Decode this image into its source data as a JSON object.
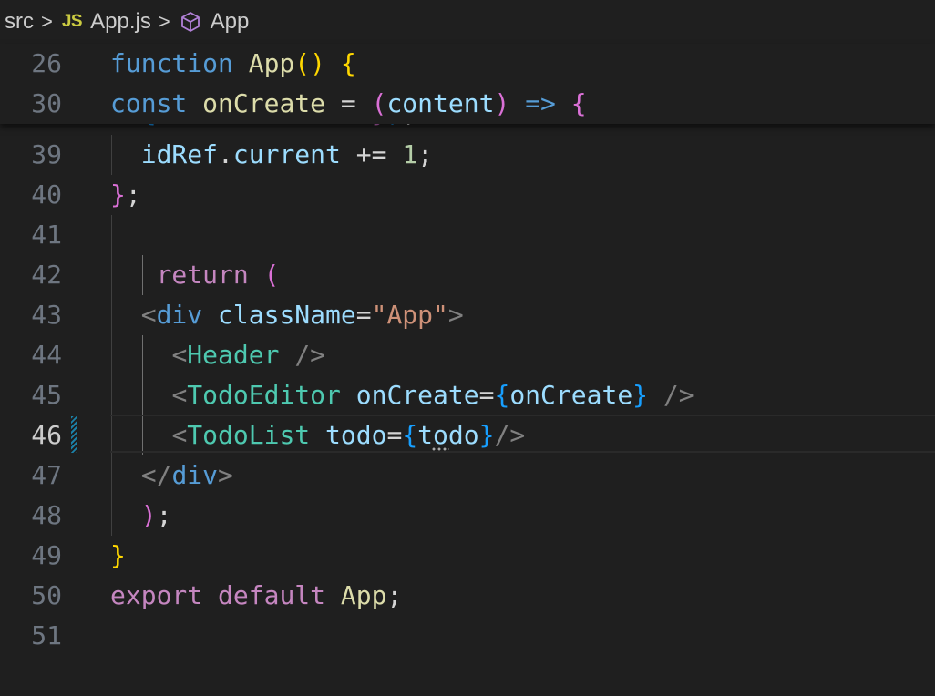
{
  "breadcrumb": {
    "folder": "src",
    "file_badge": "JS",
    "file": "App.js",
    "symbol": "App",
    "separator": ">"
  },
  "sticky": [
    {
      "num": "26",
      "tokens": [
        [
          "kw",
          "function"
        ],
        [
          "txt",
          " "
        ],
        [
          "fn",
          "App"
        ],
        [
          "b1",
          "()"
        ],
        [
          "txt",
          " "
        ],
        [
          "b1",
          "{"
        ]
      ]
    },
    {
      "num": "30",
      "tokens": [
        [
          "kw",
          "const"
        ],
        [
          "txt",
          " "
        ],
        [
          "fn",
          "onCreate"
        ],
        [
          "txt",
          " = "
        ],
        [
          "b2",
          "("
        ],
        [
          "var",
          "content"
        ],
        [
          "b2",
          ")"
        ],
        [
          "txt",
          " "
        ],
        [
          "kw",
          "=>"
        ],
        [
          "txt",
          " "
        ],
        [
          "b2",
          "{"
        ]
      ]
    }
  ],
  "lines": [
    {
      "num": "39",
      "tokens": [
        [
          "txt",
          "  "
        ],
        [
          "var",
          "idRef"
        ],
        [
          "txt",
          "."
        ],
        [
          "var",
          "current"
        ],
        [
          "txt",
          " += "
        ],
        [
          "num",
          "1"
        ],
        [
          "txt",
          ";"
        ]
      ]
    },
    {
      "num": "40",
      "tokens": [
        [
          "b2",
          "}"
        ],
        [
          "txt",
          ";"
        ]
      ]
    },
    {
      "num": "41",
      "tokens": []
    },
    {
      "num": "42",
      "tokens": [
        [
          "txt",
          "   "
        ],
        [
          "kw2",
          "return"
        ],
        [
          "txt",
          " "
        ],
        [
          "b2",
          "("
        ]
      ]
    },
    {
      "num": "43",
      "tokens": [
        [
          "txt",
          "  "
        ],
        [
          "ang",
          "<"
        ],
        [
          "htag",
          "div"
        ],
        [
          "txt",
          " "
        ],
        [
          "var",
          "className"
        ],
        [
          "txt",
          "="
        ],
        [
          "str",
          "\"App\""
        ],
        [
          "ang",
          ">"
        ]
      ]
    },
    {
      "num": "44",
      "tokens": [
        [
          "txt",
          "    "
        ],
        [
          "ang",
          "<"
        ],
        [
          "tag",
          "Header"
        ],
        [
          "txt",
          " "
        ],
        [
          "ang",
          "/>"
        ]
      ]
    },
    {
      "num": "45",
      "tokens": [
        [
          "txt",
          "    "
        ],
        [
          "ang",
          "<"
        ],
        [
          "tag",
          "TodoEditor"
        ],
        [
          "txt",
          " "
        ],
        [
          "var",
          "onCreate"
        ],
        [
          "txt",
          "="
        ],
        [
          "b3",
          "{"
        ],
        [
          "var",
          "onCreate"
        ],
        [
          "b3",
          "}"
        ],
        [
          "txt",
          " "
        ],
        [
          "ang",
          "/>"
        ]
      ]
    },
    {
      "num": "46",
      "tokens": [
        [
          "txt",
          "    "
        ],
        [
          "ang",
          "<"
        ],
        [
          "tag",
          "TodoList"
        ],
        [
          "txt",
          " "
        ],
        [
          "var",
          "todo"
        ],
        [
          "txt",
          "="
        ],
        [
          "b3",
          "{"
        ],
        [
          "var",
          "todo"
        ],
        [
          "b3",
          "}"
        ],
        [
          "ang",
          "/>"
        ]
      ],
      "active": true
    },
    {
      "num": "47",
      "tokens": [
        [
          "txt",
          "  "
        ],
        [
          "ang",
          "</"
        ],
        [
          "htag",
          "div"
        ],
        [
          "ang",
          ">"
        ]
      ]
    },
    {
      "num": "48",
      "tokens": [
        [
          "txt",
          "  "
        ],
        [
          "b2",
          ")"
        ],
        [
          "txt",
          ";"
        ]
      ]
    },
    {
      "num": "49",
      "tokens": [
        [
          "b1",
          "}"
        ]
      ]
    },
    {
      "num": "50",
      "tokens": [
        [
          "kw2",
          "export"
        ],
        [
          "txt",
          " "
        ],
        [
          "kw2",
          "default"
        ],
        [
          "txt",
          " "
        ],
        [
          "fn",
          "App"
        ],
        [
          "txt",
          ";"
        ]
      ]
    },
    {
      "num": "51",
      "tokens": []
    }
  ],
  "colors": {
    "background": "#1f1f1f",
    "keyword": "#569cd6",
    "control": "#c586c0",
    "function": "#dcdcaa",
    "variable": "#9cdcfe",
    "string": "#ce9178",
    "number": "#b5cea8",
    "component": "#4ec9b0"
  }
}
